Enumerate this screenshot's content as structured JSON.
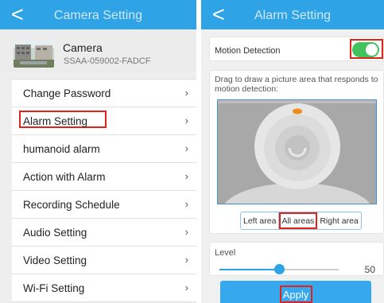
{
  "camera_setting": {
    "back": "<",
    "title": "Camera Setting",
    "device": {
      "name": "Camera",
      "id": "SSAA-059002-FADCF"
    },
    "menu": [
      {
        "label": "Change Password",
        "chevron": "›"
      },
      {
        "label": "Alarm Setting",
        "chevron": "›",
        "highlighted": true
      },
      {
        "label": "humanoid alarm",
        "chevron": "›"
      },
      {
        "label": "Action with Alarm",
        "chevron": "›"
      },
      {
        "label": "Recording Schedule",
        "chevron": "›"
      },
      {
        "label": "Audio Setting",
        "chevron": "›"
      },
      {
        "label": "Video Setting",
        "chevron": "›"
      },
      {
        "label": "Wi-Fi Setting",
        "chevron": "›"
      }
    ]
  },
  "alarm_setting": {
    "back": "<",
    "title": "Alarm Setting",
    "motion_detection": {
      "label": "Motion Detection",
      "enabled": true
    },
    "instructions": "Drag to draw a picture area that responds to motion detection:",
    "area_options": [
      "Left area",
      "All areas",
      "Right area"
    ],
    "selected_area": "All areas",
    "level": {
      "label": "Level",
      "value": "50",
      "fraction": 0.5
    },
    "apply_label": "Apply"
  },
  "colors": {
    "header": "#2ea3e6",
    "toggle_on": "#42c25f",
    "highlight": "#e2231a",
    "apply": "#36a9ee"
  }
}
